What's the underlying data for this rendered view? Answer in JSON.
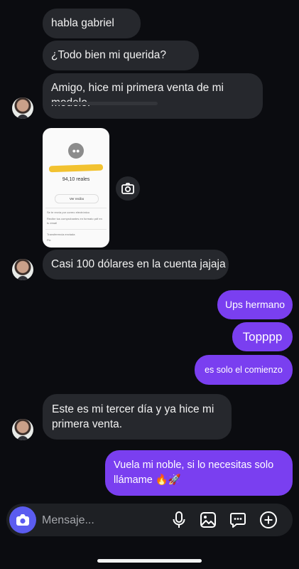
{
  "messages": {
    "m1": "habla gabriel",
    "m2": "¿Todo bien mi querida?",
    "m3": "Amigo, hice mi primera venta de mi modelo.",
    "m4": "Casi 100 dólares en la cuenta jajaja",
    "m5": "Ups hermano",
    "m6": "Topppp",
    "m7": "es solo el comienzo",
    "m8": "Este es mi tercer día y ya hice mi primera venta.",
    "m9": "Vuela mi noble, si lo necesitas solo llámame 🔥🚀"
  },
  "receipt": {
    "amount": "94,10 reales",
    "button": "Ver recibo",
    "note1": "Se te envía por correo electrónico",
    "note2": "Recibe tus comprobantes en formato pdf en tu email",
    "status": "Transferencia enviada",
    "status_sub": "Pix"
  },
  "composer": {
    "placeholder": "Mensaje..."
  },
  "colors": {
    "background": "#0b0c10",
    "incoming": "#26282d",
    "outgoing": "#7a3ff0",
    "camera": "#5b5cf0"
  },
  "icons": [
    "camera-icon",
    "microphone-icon",
    "image-icon",
    "sticker-icon",
    "plus-icon"
  ]
}
